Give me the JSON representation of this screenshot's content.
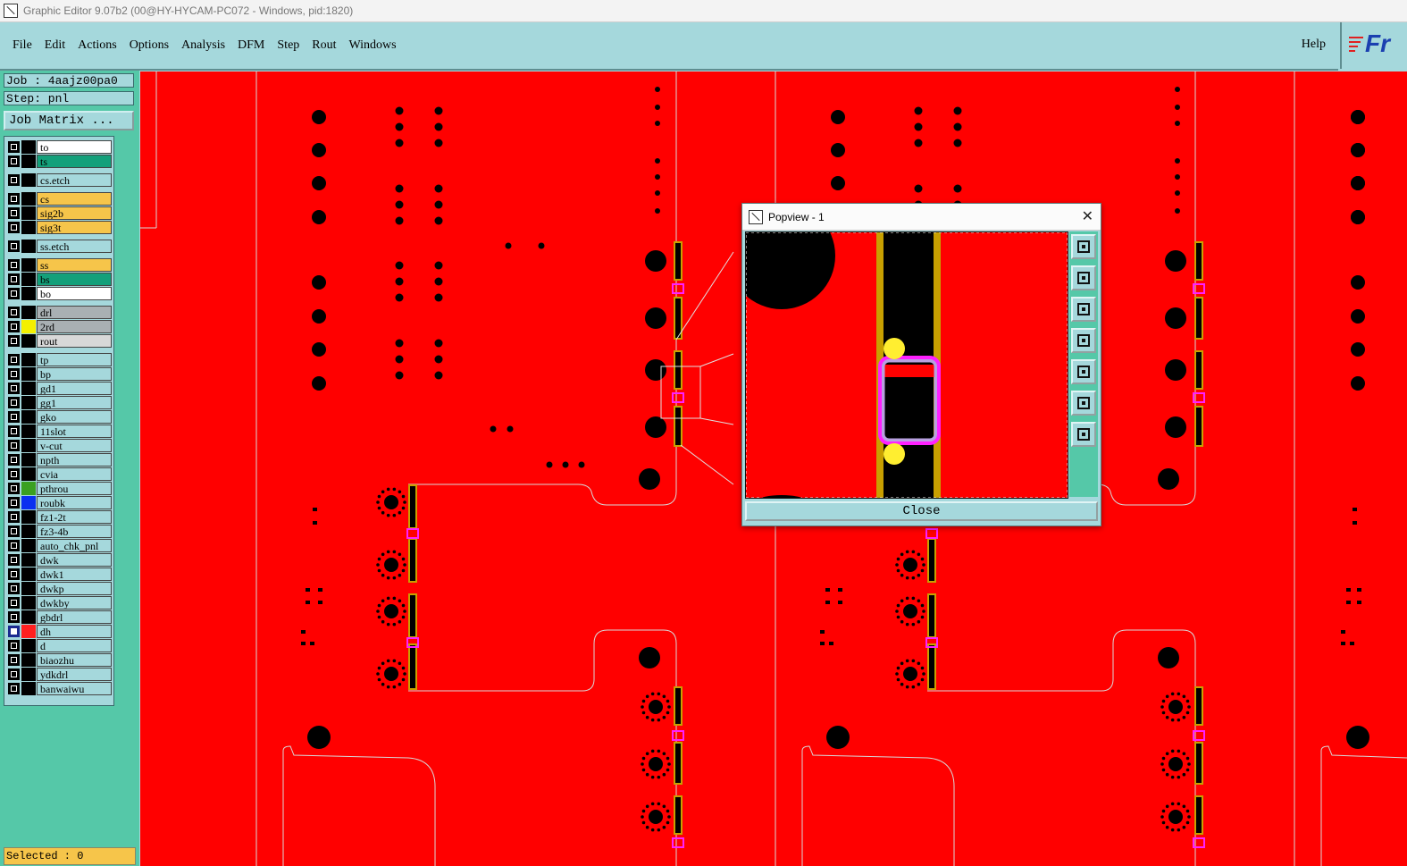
{
  "window": {
    "title": "Graphic Editor 9.07b2 (00@HY-HYCAM-PC072 - Windows, pid:1820)"
  },
  "menu": {
    "items": [
      {
        "label": "File"
      },
      {
        "label": "Edit"
      },
      {
        "label": "Actions"
      },
      {
        "label": "Options"
      },
      {
        "label": "Analysis"
      },
      {
        "label": "DFM"
      },
      {
        "label": "Step"
      },
      {
        "label": "Rout"
      },
      {
        "label": "Windows"
      }
    ],
    "help": "Help"
  },
  "logo": {
    "text": "Fr"
  },
  "job": {
    "job_line": "Job : 4aajz00pa0",
    "step_line": "Step: pnl",
    "matrix_button": "Job Matrix ..."
  },
  "layers": [
    {
      "name": "to",
      "color": "#ffffff",
      "swatch": "#000000"
    },
    {
      "name": "ts",
      "color": "#13a07a",
      "swatch": "#000000"
    },
    {
      "name": "cs.etch",
      "color": "#a5d8dc",
      "swatch": "#000000",
      "gap": true
    },
    {
      "name": "cs",
      "color": "#f6c54a",
      "swatch": "#000000",
      "gap": true
    },
    {
      "name": "sig2b",
      "color": "#f6c54a",
      "swatch": "#000000"
    },
    {
      "name": "sig3t",
      "color": "#f6c54a",
      "swatch": "#000000"
    },
    {
      "name": "ss.etch",
      "color": "#a5d8dc",
      "swatch": "#000000",
      "gap": true
    },
    {
      "name": "ss",
      "color": "#f6c54a",
      "swatch": "#000000",
      "gap": true
    },
    {
      "name": "bs",
      "color": "#13a07a",
      "swatch": "#000000"
    },
    {
      "name": "bo",
      "color": "#ffffff",
      "swatch": "#000000"
    },
    {
      "name": "drl",
      "color": "#a9b0b3",
      "swatch": "#000000",
      "gap": true
    },
    {
      "name": "2rd",
      "color": "#a9b0b3",
      "swatch": "#f4f000"
    },
    {
      "name": "rout",
      "color": "#d8d8d8",
      "swatch": "#000000"
    },
    {
      "name": "tp",
      "color": "#a5d8dc",
      "swatch": "#000000",
      "gap": true
    },
    {
      "name": "bp",
      "color": "#a5d8dc",
      "swatch": "#000000"
    },
    {
      "name": "gd1",
      "color": "#a5d8dc",
      "swatch": "#000000"
    },
    {
      "name": "gg1",
      "color": "#a5d8dc",
      "swatch": "#000000"
    },
    {
      "name": "gko",
      "color": "#a5d8dc",
      "swatch": "#000000"
    },
    {
      "name": "11slot",
      "color": "#a5d8dc",
      "swatch": "#000000"
    },
    {
      "name": "v-cut",
      "color": "#a5d8dc",
      "swatch": "#000000"
    },
    {
      "name": "npth",
      "color": "#a5d8dc",
      "swatch": "#000000"
    },
    {
      "name": "cvia",
      "color": "#a5d8dc",
      "swatch": "#000000"
    },
    {
      "name": "pthrou",
      "color": "#a5d8dc",
      "swatch": "#3aa020"
    },
    {
      "name": "roubk",
      "color": "#a5d8dc",
      "swatch": "#0a30f0"
    },
    {
      "name": "fz1-2t",
      "color": "#a5d8dc",
      "swatch": "#000000"
    },
    {
      "name": "fz3-4b",
      "color": "#a5d8dc",
      "swatch": "#000000"
    },
    {
      "name": "auto_chk_pnl",
      "color": "#a5d8dc",
      "swatch": "#000000"
    },
    {
      "name": "dwk",
      "color": "#a5d8dc",
      "swatch": "#000000"
    },
    {
      "name": "dwk1",
      "color": "#a5d8dc",
      "swatch": "#000000"
    },
    {
      "name": "dwkp",
      "color": "#a5d8dc",
      "swatch": "#000000"
    },
    {
      "name": "dwkby",
      "color": "#a5d8dc",
      "swatch": "#000000"
    },
    {
      "name": "gbdrl",
      "color": "#a5d8dc",
      "swatch": "#000000"
    },
    {
      "name": "dh",
      "color": "#a5d8dc",
      "swatch": "#ff2020",
      "active": true
    },
    {
      "name": "d",
      "color": "#a5d8dc",
      "swatch": "#000000"
    },
    {
      "name": "biaozhu",
      "color": "#a5d8dc",
      "swatch": "#000000"
    },
    {
      "name": "ydkdrl",
      "color": "#a5d8dc",
      "swatch": "#000000"
    },
    {
      "name": "banwaiwu",
      "color": "#a5d8dc",
      "swatch": "#000000"
    }
  ],
  "status": {
    "text": "Selected : 0"
  },
  "popview": {
    "title": "Popview - 1",
    "close_label": "Close",
    "tools": [
      "zoom-fit-icon",
      "pan-up-icon",
      "pan-down-icon",
      "pan-left-icon",
      "pan-right-icon",
      "zoom-in-icon",
      "zoom-out-icon"
    ]
  },
  "colors": {
    "board": "#ff0000",
    "pad": "#000000",
    "outline": "#d8d8d8",
    "gold": "#c8a000",
    "magenta": "#ff20ff",
    "yellow": "#ffee30"
  }
}
